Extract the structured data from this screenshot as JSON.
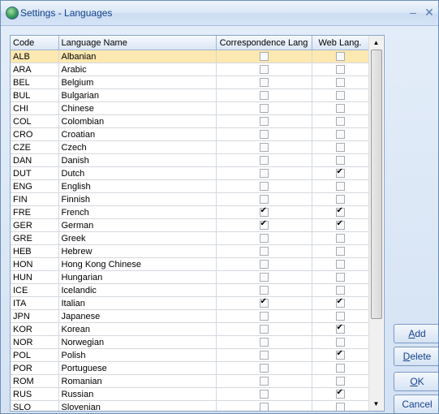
{
  "window": {
    "title": "Settings - Languages",
    "minimize_glyph": "–",
    "close_glyph": "✕"
  },
  "grid": {
    "columns": [
      "Code",
      "Language Name",
      "Correspondence Lang",
      "Web Lang."
    ],
    "rows": [
      {
        "code": "ALB",
        "name": "Albanian",
        "corr": false,
        "web": false,
        "selected": true
      },
      {
        "code": "ARA",
        "name": "Arabic",
        "corr": false,
        "web": false
      },
      {
        "code": "BEL",
        "name": "Belgium",
        "corr": false,
        "web": false
      },
      {
        "code": "BUL",
        "name": "Bulgarian",
        "corr": false,
        "web": false
      },
      {
        "code": "CHI",
        "name": "Chinese",
        "corr": false,
        "web": false
      },
      {
        "code": "COL",
        "name": "Colombian",
        "corr": false,
        "web": false
      },
      {
        "code": "CRO",
        "name": "Croatian",
        "corr": false,
        "web": false
      },
      {
        "code": "CZE",
        "name": "Czech",
        "corr": false,
        "web": false
      },
      {
        "code": "DAN",
        "name": "Danish",
        "corr": false,
        "web": false
      },
      {
        "code": "DUT",
        "name": "Dutch",
        "corr": false,
        "web": true
      },
      {
        "code": "ENG",
        "name": "English",
        "corr": false,
        "web": false
      },
      {
        "code": "FIN",
        "name": "Finnish",
        "corr": false,
        "web": false
      },
      {
        "code": "FRE",
        "name": "French",
        "corr": true,
        "web": true
      },
      {
        "code": "GER",
        "name": "German",
        "corr": true,
        "web": true
      },
      {
        "code": "GRE",
        "name": "Greek",
        "corr": false,
        "web": false
      },
      {
        "code": "HEB",
        "name": "Hebrew",
        "corr": false,
        "web": false
      },
      {
        "code": "HON",
        "name": "Hong Kong Chinese",
        "corr": false,
        "web": false
      },
      {
        "code": "HUN",
        "name": "Hungarian",
        "corr": false,
        "web": false
      },
      {
        "code": "ICE",
        "name": "Icelandic",
        "corr": false,
        "web": false
      },
      {
        "code": "ITA",
        "name": "Italian",
        "corr": true,
        "web": true
      },
      {
        "code": "JPN",
        "name": "Japanese",
        "corr": false,
        "web": false
      },
      {
        "code": "KOR",
        "name": "Korean",
        "corr": false,
        "web": true
      },
      {
        "code": "NOR",
        "name": "Norwegian",
        "corr": false,
        "web": false
      },
      {
        "code": "POL",
        "name": "Polish",
        "corr": false,
        "web": true
      },
      {
        "code": "POR",
        "name": "Portuguese",
        "corr": false,
        "web": false
      },
      {
        "code": "ROM",
        "name": "Romanian",
        "corr": false,
        "web": false
      },
      {
        "code": "RUS",
        "name": "Russian",
        "corr": false,
        "web": true
      },
      {
        "code": "SLO",
        "name": "Slovenian",
        "corr": false,
        "web": false
      }
    ]
  },
  "buttons": {
    "add": {
      "first": "A",
      "rest": "dd"
    },
    "delete": {
      "first": "D",
      "rest": "elete"
    },
    "ok": {
      "first": "O",
      "rest": "K"
    },
    "cancel": {
      "first": "",
      "rest": "Cancel"
    }
  },
  "colors": {
    "title_text": "#15428b",
    "selected_row": "#fce8b0",
    "accent": "#7a98c2"
  }
}
